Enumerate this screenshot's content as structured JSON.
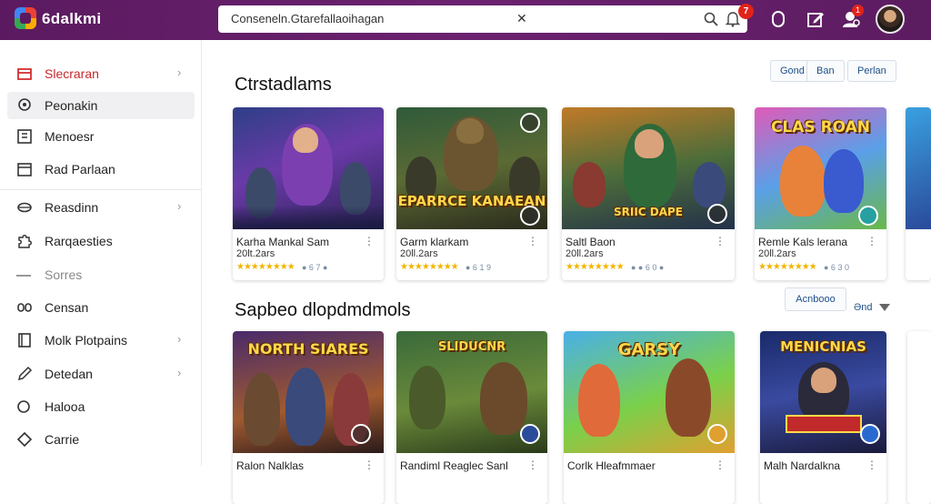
{
  "app": {
    "brand": "6dalkmi"
  },
  "search": {
    "value": "Conseneln.Gtarefallaoihagan",
    "clear": "✕"
  },
  "header": {
    "notifications_count": "7",
    "messages_count": "1"
  },
  "sidebar": {
    "items": [
      {
        "label": "Slecraran",
        "icon": "store-icon",
        "chevron": "›"
      },
      {
        "label": "Peonakin",
        "icon": "podcast-icon"
      },
      {
        "label": "Menoesr",
        "icon": "menu-list-icon"
      },
      {
        "label": "Rad  Parlaan",
        "icon": "calendar-icon"
      },
      {
        "label": "Reasdinn",
        "icon": "cloud-icon",
        "chevron": "›"
      },
      {
        "label": "Rarqaesties",
        "icon": "puzzle-icon"
      },
      {
        "label": "Sorres",
        "icon": "dash-icon"
      },
      {
        "label": "Censan",
        "icon": "people-icon"
      },
      {
        "label": "Molk Plotpains",
        "icon": "book-icon",
        "chevron": "›"
      },
      {
        "label": "Detedan",
        "icon": "pen-icon",
        "chevron": "›"
      },
      {
        "label": "Halooa",
        "icon": "circle-icon"
      },
      {
        "label": "Carrie",
        "icon": "diamond-icon"
      }
    ]
  },
  "filters": [
    "Gond",
    "Ban",
    "Perlan"
  ],
  "section1": {
    "title": "Ctrstadlams",
    "cards": [
      {
        "art": "",
        "title": "Karha  Mankal Sam",
        "sub": "20lt.2ars",
        "stars": "★★★★★★★★",
        "score": "● 6 7 ●",
        "menu": "⋮"
      },
      {
        "art": "EPARRCE KANAEAN",
        "title": "Garm  klarkam",
        "sub": "20ll.2ars",
        "stars": "★★★★★★★★",
        "score": "● 6 1 9",
        "menu": "⋮"
      },
      {
        "art": "SRIIC DAPE",
        "title": "Saltl  Baon",
        "sub": "20ll.2ars",
        "stars": "★★★★★★★★",
        "score": "● ● 6 0 ●",
        "menu": "⋮"
      },
      {
        "art": "CLAS ROAN",
        "title": "Remle  Kals  lerana",
        "sub": "20ll.2ars",
        "stars": "★★★★★★★★",
        "score": "● 6 3 0",
        "menu": "⋮"
      }
    ]
  },
  "section2": {
    "title": "Sapbeo  dlopdmdmols",
    "see_all": "Acnbooo",
    "and_label": "Ənd",
    "cards": [
      {
        "art": "NORTH SIARES",
        "title": "Ralon  Nalklas",
        "menu": "⋮"
      },
      {
        "art": "SLIDUCNR",
        "title": "Randiml  Reaglec Sanl",
        "menu": "⋮"
      },
      {
        "art": "GARSY",
        "title": "Corlk  Hleafmmaer",
        "menu": "⋮"
      },
      {
        "art": "MENICNIAS",
        "title": "Malh  Nardalkna",
        "menu": "⋮"
      }
    ]
  },
  "colors": {
    "topbar": "#5b1a5f",
    "accent_red": "#e2231a",
    "link_blue": "#1d4f8a",
    "star": "#f4b400"
  }
}
